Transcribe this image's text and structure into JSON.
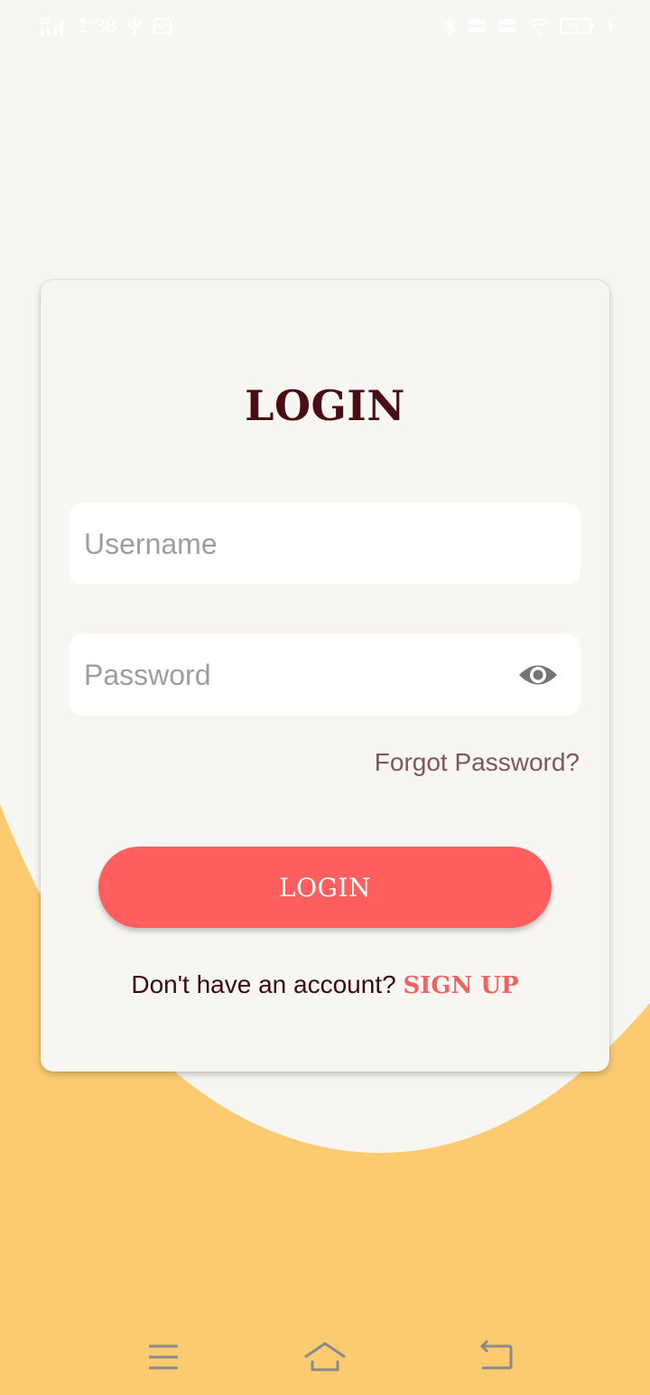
{
  "status_bar": {
    "network": "4G",
    "time": "1:38",
    "battery_level": "77"
  },
  "login": {
    "title": "LOGIN",
    "username_placeholder": "Username",
    "password_placeholder": "Password",
    "forgot_password": "Forgot Password?",
    "login_button": "LOGIN",
    "signup_prompt": "Don't have an account? ",
    "signup_link": "SIGN UP"
  },
  "colors": {
    "background": "#f8f6f2",
    "wave": "#fccb70",
    "title": "#4a0d14",
    "button": "#ff5e5e",
    "link": "#f26262"
  },
  "icons": {
    "password_toggle": "eye-icon",
    "nav_menu": "menu-icon",
    "nav_home": "home-icon",
    "nav_back": "back-icon"
  }
}
